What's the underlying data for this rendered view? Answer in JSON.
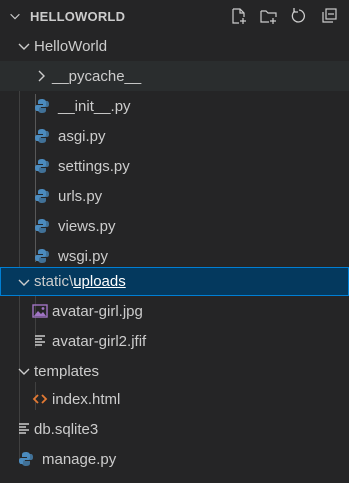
{
  "explorer": {
    "title": "HELLOWORLD",
    "actions": [
      {
        "name": "new-file-icon"
      },
      {
        "name": "new-folder-icon"
      },
      {
        "name": "refresh-icon"
      },
      {
        "name": "collapse-all-icon"
      }
    ]
  },
  "tree": {
    "helloworld_folder": "HelloWorld",
    "pycache": "__pycache__",
    "init": "__init__.py",
    "asgi": "asgi.py",
    "settings": "settings.py",
    "urls": "urls.py",
    "views": "views.py",
    "wsgi": "wsgi.py",
    "static": "static",
    "path_sep": "\\",
    "uploads": "uploads",
    "avatar1": "avatar-girl.jpg",
    "avatar2": "avatar-girl2.jfif",
    "templates": "templates",
    "index": "index.html",
    "db": "db.sqlite3",
    "manage": "manage.py"
  },
  "colors": {
    "background": "#252526",
    "selection": "#04395e",
    "focus_border": "#007fd4",
    "python_icon": "#4b8bbe",
    "html_icon": "#e37933",
    "image_icon": "#a074c4"
  }
}
